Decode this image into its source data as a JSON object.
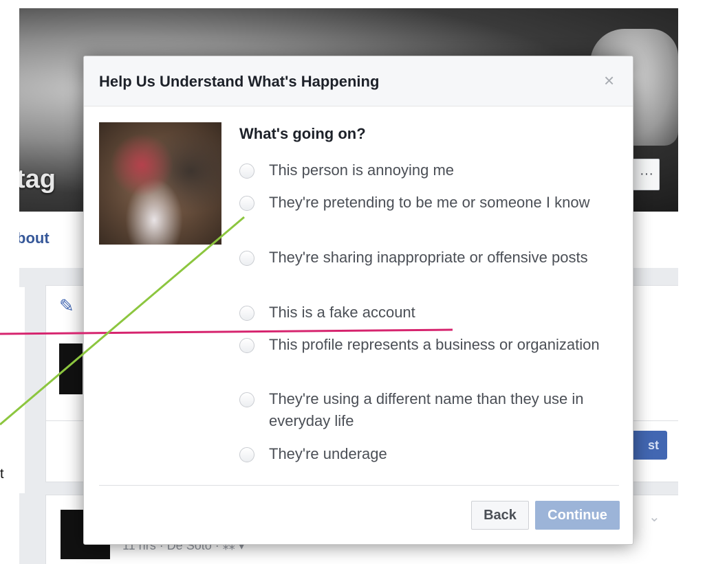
{
  "profile": {
    "name_fragment": "tag",
    "nav_about": "bout",
    "more_button": "···",
    "post_button": "st",
    "feed_meta": "11 hrs · De Soto · ⁂ ▾",
    "feed_chevron": "⌄"
  },
  "outside_text": "t",
  "dialog": {
    "title": "Help Us Understand What's Happening",
    "close_glyph": "×",
    "question": "What's going on?",
    "options": [
      {
        "label": "This person is annoying me"
      },
      {
        "label": "They're pretending to be me or someone I know"
      },
      {
        "label": "They're sharing inappropriate or offensive posts"
      },
      {
        "label": "This is a fake account"
      },
      {
        "label": "This profile represents a business or organization"
      },
      {
        "label": "They're using a different name than they use in everyday life"
      },
      {
        "label": "They're underage"
      }
    ],
    "back_label": "Back",
    "continue_label": "Continue"
  },
  "colors": {
    "accent": "#4267b2",
    "continue_disabled": "#9cb4d8",
    "annotation_pink": "#d6246e",
    "annotation_green": "#8cc63f"
  },
  "icons": {
    "close": "close-icon",
    "edit": "pencil-icon",
    "chevron": "chevron-down-icon"
  }
}
